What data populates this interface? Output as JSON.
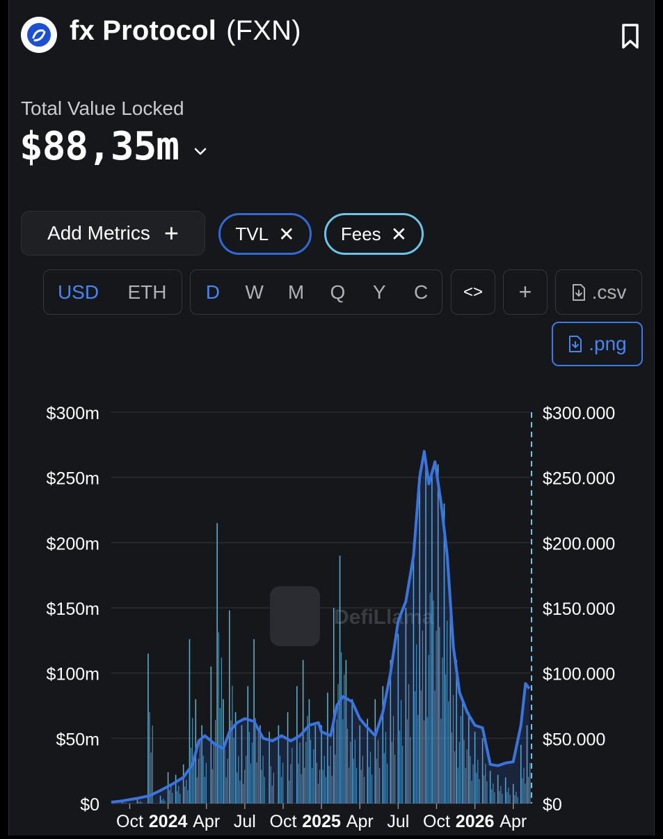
{
  "header": {
    "name": "fx Protocol",
    "ticker": "(FXN)",
    "logo_icon": "fx-protocol-logo-icon",
    "bookmark_icon": "bookmark-icon"
  },
  "summary": {
    "label": "Total Value Locked",
    "value": "$88,35m"
  },
  "controls": {
    "add_metrics": "Add Metrics",
    "add_metrics_icon": "+",
    "metrics": [
      {
        "label": "TVL",
        "color": "#2f6ad8"
      },
      {
        "label": "Fees",
        "color": "#6bc4ea"
      }
    ],
    "remove_icon": "✕",
    "currencies": [
      "USD",
      "ETH"
    ],
    "currency_active": "USD",
    "periods": [
      "D",
      "W",
      "M",
      "Q",
      "Y",
      "C"
    ],
    "period_active": "D",
    "embed_icon": "<>",
    "add_icon": "+",
    "csv_label": ".csv",
    "png_label": ".png"
  },
  "watermark": "DefiLlama",
  "chart_data": {
    "type": "line",
    "left_axis": {
      "ticks": [
        "$0",
        "$50m",
        "$100m",
        "$150m",
        "$200m",
        "$250m",
        "$300m"
      ],
      "ylim": [
        0,
        300
      ]
    },
    "right_axis": {
      "ticks": [
        "$0",
        "$50.000",
        "$100.000",
        "$150.000",
        "$200.000",
        "$250.000",
        "$300.000"
      ],
      "ylim": [
        0,
        300000
      ]
    },
    "x_ticks": [
      {
        "label": "Oct",
        "bold": false,
        "t": 2023.75
      },
      {
        "label": "2024",
        "bold": true,
        "t": 2024.0
      },
      {
        "label": "Apr",
        "bold": false,
        "t": 2024.25
      },
      {
        "label": "Jul",
        "bold": false,
        "t": 2024.5
      },
      {
        "label": "Oct",
        "bold": false,
        "t": 2024.75
      },
      {
        "label": "2025",
        "bold": true,
        "t": 2025.0
      },
      {
        "label": "Apr",
        "bold": false,
        "t": 2025.25
      },
      {
        "label": "Jul",
        "bold": false,
        "t": 2025.5
      },
      {
        "label": "Oct",
        "bold": false,
        "t": 2025.75
      },
      {
        "label": "2026",
        "bold": true,
        "t": 2026.0
      },
      {
        "label": "Apr",
        "bold": false,
        "t": 2026.25
      }
    ],
    "xlim": [
      2023.63,
      2026.36
    ],
    "series": [
      {
        "name": "TVL",
        "axis": "left",
        "color": "#3b74de",
        "points": [
          [
            2023.63,
            1
          ],
          [
            2023.7,
            2
          ],
          [
            2023.8,
            4
          ],
          [
            2023.88,
            6
          ],
          [
            2023.95,
            10
          ],
          [
            2024.03,
            15
          ],
          [
            2024.1,
            20
          ],
          [
            2024.16,
            30
          ],
          [
            2024.2,
            48
          ],
          [
            2024.24,
            52
          ],
          [
            2024.3,
            46
          ],
          [
            2024.36,
            42
          ],
          [
            2024.4,
            55
          ],
          [
            2024.45,
            62
          ],
          [
            2024.5,
            65
          ],
          [
            2024.56,
            63
          ],
          [
            2024.62,
            50
          ],
          [
            2024.68,
            48
          ],
          [
            2024.74,
            52
          ],
          [
            2024.8,
            48
          ],
          [
            2024.86,
            52
          ],
          [
            2024.92,
            60
          ],
          [
            2024.98,
            62
          ],
          [
            2025.0,
            55
          ],
          [
            2025.06,
            52
          ],
          [
            2025.1,
            75
          ],
          [
            2025.14,
            82
          ],
          [
            2025.2,
            78
          ],
          [
            2025.25,
            65
          ],
          [
            2025.3,
            58
          ],
          [
            2025.35,
            52
          ],
          [
            2025.4,
            70
          ],
          [
            2025.45,
            100
          ],
          [
            2025.5,
            140
          ],
          [
            2025.55,
            155
          ],
          [
            2025.6,
            190
          ],
          [
            2025.64,
            250
          ],
          [
            2025.67,
            270
          ],
          [
            2025.7,
            245
          ],
          [
            2025.74,
            262
          ],
          [
            2025.78,
            230
          ],
          [
            2025.82,
            190
          ],
          [
            2025.86,
            120
          ],
          [
            2025.9,
            85
          ],
          [
            2025.95,
            70
          ],
          [
            2026.0,
            60
          ],
          [
            2026.05,
            58
          ],
          [
            2026.1,
            30
          ],
          [
            2026.15,
            29
          ],
          [
            2026.2,
            31
          ],
          [
            2026.25,
            32
          ],
          [
            2026.3,
            60
          ],
          [
            2026.33,
            92
          ],
          [
            2026.355,
            88
          ]
        ]
      },
      {
        "name": "Fees",
        "axis": "right",
        "color": "#6bc4ea",
        "points": [
          [
            2023.7,
            1000
          ],
          [
            2023.8,
            3000
          ],
          [
            2023.87,
            115000
          ],
          [
            2023.95,
            6000
          ],
          [
            2024.0,
            24000
          ],
          [
            2024.05,
            22000
          ],
          [
            2024.1,
            30000
          ],
          [
            2024.14,
            126000
          ],
          [
            2024.18,
            80000
          ],
          [
            2024.22,
            60000
          ],
          [
            2024.28,
            105000
          ],
          [
            2024.32,
            215000
          ],
          [
            2024.36,
            80000
          ],
          [
            2024.4,
            148000
          ],
          [
            2024.44,
            70000
          ],
          [
            2024.48,
            60000
          ],
          [
            2024.52,
            90000
          ],
          [
            2024.56,
            126000
          ],
          [
            2024.6,
            60000
          ],
          [
            2024.66,
            55000
          ],
          [
            2024.72,
            60000
          ],
          [
            2024.78,
            70000
          ],
          [
            2024.84,
            90000
          ],
          [
            2024.88,
            110000
          ],
          [
            2024.92,
            80000
          ],
          [
            2024.96,
            60000
          ],
          [
            2025.0,
            60000
          ],
          [
            2025.04,
            85000
          ],
          [
            2025.08,
            150000
          ],
          [
            2025.12,
            190000
          ],
          [
            2025.16,
            110000
          ],
          [
            2025.2,
            80000
          ],
          [
            2025.25,
            60000
          ],
          [
            2025.3,
            65000
          ],
          [
            2025.35,
            80000
          ],
          [
            2025.4,
            90000
          ],
          [
            2025.45,
            110000
          ],
          [
            2025.5,
            130000
          ],
          [
            2025.55,
            150000
          ],
          [
            2025.6,
            200000
          ],
          [
            2025.64,
            255000
          ],
          [
            2025.68,
            265000
          ],
          [
            2025.72,
            255000
          ],
          [
            2025.76,
            260000
          ],
          [
            2025.8,
            230000
          ],
          [
            2025.84,
            160000
          ],
          [
            2025.88,
            110000
          ],
          [
            2025.92,
            80000
          ],
          [
            2025.96,
            70000
          ],
          [
            2026.0,
            55000
          ],
          [
            2026.05,
            50000
          ],
          [
            2026.1,
            25000
          ],
          [
            2026.15,
            22000
          ],
          [
            2026.2,
            20000
          ],
          [
            2026.25,
            15000
          ],
          [
            2026.3,
            45000
          ],
          [
            2026.34,
            60000
          ]
        ]
      }
    ],
    "title": "",
    "xlabel": "",
    "ylabel": "",
    "grid": true
  }
}
